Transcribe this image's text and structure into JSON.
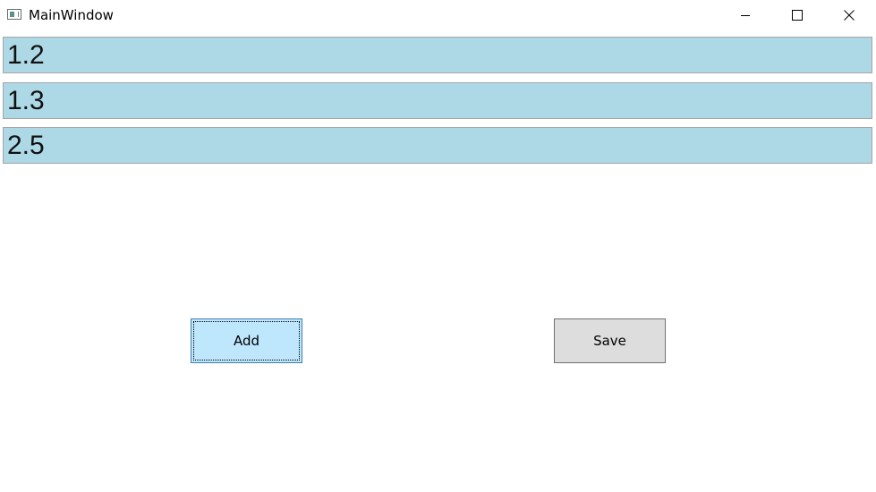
{
  "window": {
    "title": "MainWindow"
  },
  "title_buttons": {
    "minimize_icon": "minimize-icon",
    "maximize_icon": "maximize-icon",
    "close_icon": "close-icon"
  },
  "list": {
    "items": [
      {
        "value": "1.2"
      },
      {
        "value": "1.3"
      },
      {
        "value": "2.5"
      }
    ],
    "row_color": "#add8e6"
  },
  "buttons": {
    "add_label": "Add",
    "save_label": "Save"
  }
}
